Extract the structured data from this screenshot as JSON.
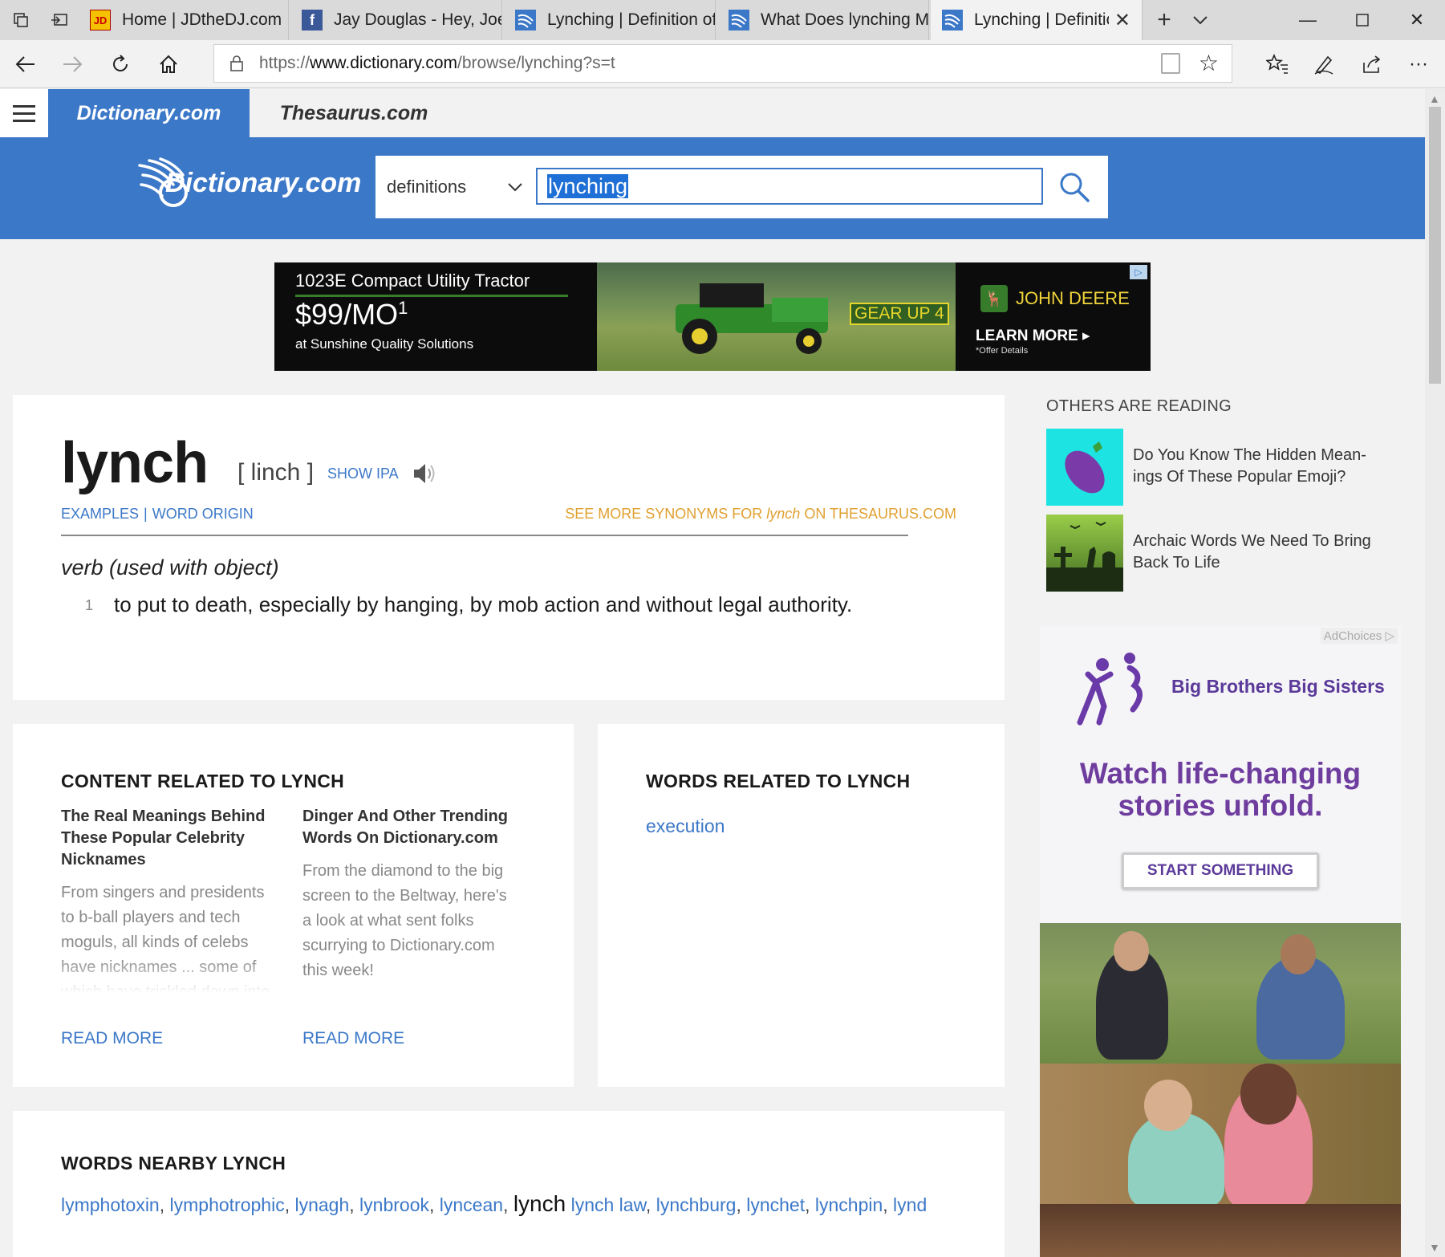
{
  "browser": {
    "tabs": [
      {
        "title": "Home | JDtheDJ.com",
        "favicon": "jdthedj-icon"
      },
      {
        "title": "Jay Douglas - Hey, Joe I",
        "favicon": "facebook-icon"
      },
      {
        "title": "Lynching | Definition of",
        "favicon": "dictionary-icon"
      },
      {
        "title": "What Does lynching Me",
        "favicon": "dictionary-icon"
      },
      {
        "title": "Lynching | Definitio",
        "favicon": "dictionary-icon",
        "active": true
      }
    ],
    "address": {
      "prefix": "https://",
      "domain": "www.dictionary.com",
      "path": "/browse/lynching?s=t"
    }
  },
  "site": {
    "tab_dictionary": "Dictionary.com",
    "tab_thesaurus": "Thesaurus.com",
    "logo_text": "Dictionary.com",
    "brand_color": "#3c78c8"
  },
  "search": {
    "type": "definitions",
    "query": "lynching"
  },
  "ad_top": {
    "line1": "1023E Compact Utility Tractor",
    "price": "$99/MO",
    "price_sup": "1",
    "line3": "at Sunshine Quality Solutions",
    "badge": "GEAR UP 4",
    "brand": "JOHN DEERE",
    "cta": "LEARN MORE",
    "fine": "*Offer Details"
  },
  "entry": {
    "headword": "lynch",
    "pronunciation": "[ linch ]",
    "show_ipa": "SHOW IPA",
    "link_examples": "EXAMPLES",
    "link_sep": "|",
    "link_origin": "WORD ORIGIN",
    "syn_prefix": "SEE MORE SYNONYMS FOR ",
    "syn_word": "lynch",
    "syn_suffix": " ON THESAURUS.COM",
    "part_of_speech": "verb (used with object)",
    "sense_number": "1",
    "sense_text": "to put to death, especially by hanging, by mob action and without legal authority."
  },
  "content_related": {
    "heading": "CONTENT RELATED TO LYNCH",
    "items": [
      {
        "title": "The Real Meanings Behind These Popular Celebrity Nicknames",
        "summary": "From singers and presidents to b-ball players and tech moguls, all kinds of celebs have nicknames ... some of which have trickled down into",
        "cta": "READ MORE"
      },
      {
        "title": "Dinger And Other Trending Words On Dictionary.com",
        "summary": "From the diamond to the big screen to the Beltway, here's a look at what sent folks scurrying to Dictionary.com this week!",
        "cta": "READ MORE"
      }
    ]
  },
  "words_related": {
    "heading": "WORDS RELATED TO LYNCH",
    "items": [
      "execution"
    ]
  },
  "nearby": {
    "heading": "WORDS NEARBY LYNCH",
    "before": [
      "lymphotoxin",
      "lymphotrophic",
      "lynagh",
      "lynbrook",
      "lyncean"
    ],
    "current": "lynch",
    "after": [
      "lynch law",
      "lynchburg",
      "lynchet",
      "lynchpin",
      "lynd"
    ]
  },
  "others_reading": {
    "heading": "OTHERS ARE READING",
    "items": [
      {
        "title": "Do You Know The Hidden Mean- ings Of These Popular Emoji?",
        "thumb": "eggplant-emoji-icon"
      },
      {
        "title": "Archaic Words We Need To Bring Back To Life",
        "thumb": "graveyard-illustration"
      }
    ]
  },
  "ad_side": {
    "adchoices": "AdChoices",
    "org": "Big Brothers Big Sisters",
    "headline": "Watch life-changing stories unfold.",
    "cta": "START SOMETHING"
  }
}
